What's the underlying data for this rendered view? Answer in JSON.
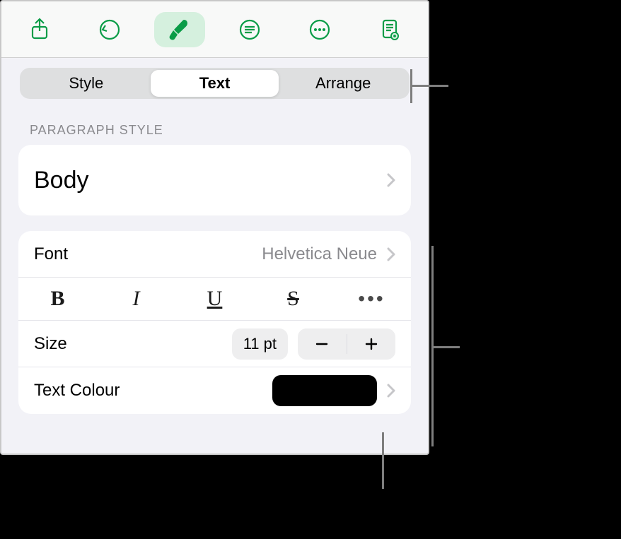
{
  "toolbar": {
    "share_icon": "share-icon",
    "undo_icon": "undo-icon",
    "format_icon": "brush-icon",
    "insert_icon": "insert-icon",
    "more_icon": "ellipsis-circle-icon",
    "document_icon": "doc-view-icon"
  },
  "segmented": {
    "items": [
      "Style",
      "Text",
      "Arrange"
    ],
    "selected": "Text"
  },
  "section_header": "Paragraph Style",
  "paragraph_style": {
    "label": "Body"
  },
  "font": {
    "label": "Font",
    "value": "Helvetica Neue"
  },
  "styles": {
    "bold": "B",
    "italic": "I",
    "underline": "U",
    "strike": "S",
    "more": "•••"
  },
  "size": {
    "label": "Size",
    "value": "11 pt"
  },
  "text_colour": {
    "label": "Text Colour",
    "value": "#000000"
  }
}
